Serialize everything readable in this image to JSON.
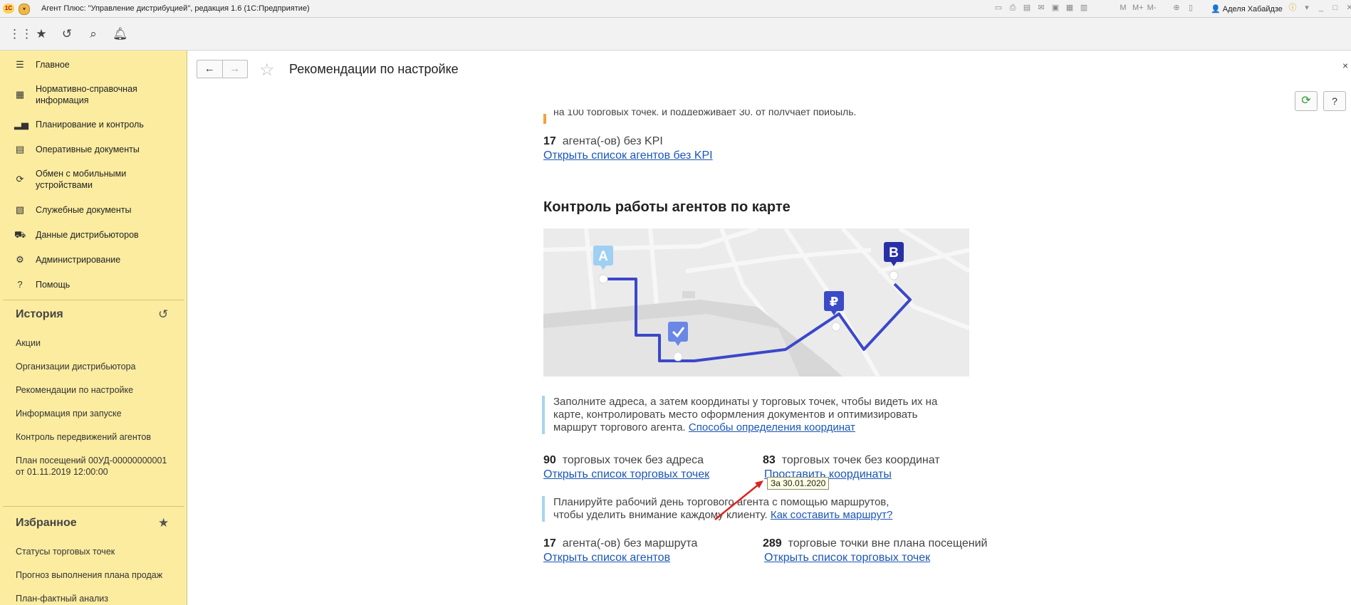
{
  "window": {
    "logo": "1С",
    "title": "Агент Плюс: \"Управление дистрибуцией\", редакция 1.6  (1С:Предприятие)",
    "user": "Аделя Хабайдзе",
    "memory_labels": [
      "M",
      "M+",
      "M-"
    ]
  },
  "sidebar": {
    "items": [
      {
        "label": "Главное",
        "icon": "menu-icon"
      },
      {
        "label": "Нормативно-справочная информация",
        "icon": "grid-icon"
      },
      {
        "label": "Планирование и контроль",
        "icon": "chart-icon"
      },
      {
        "label": "Оперативные документы",
        "icon": "docs-icon"
      },
      {
        "label": "Обмен с мобильными устройствами",
        "icon": "sync-icon"
      },
      {
        "label": "Служебные документы",
        "icon": "service-docs-icon"
      },
      {
        "label": "Данные дистрибьюторов",
        "icon": "distributor-icon"
      },
      {
        "label": "Администрирование",
        "icon": "gear-icon"
      },
      {
        "label": "Помощь",
        "icon": "question-icon"
      }
    ],
    "history_title": "История",
    "history_items": [
      "Акции",
      "Организации дистрибьютора",
      "Рекомендации по настройке",
      "Информация при запуске",
      "Контроль передвижений агентов",
      "План посещений 00УД-00000000001 от 01.11.2019 12:00:00"
    ],
    "favorites_title": "Избранное",
    "favorites_items": [
      "Статусы торговых точек",
      "Прогноз выполнения плана продаж",
      "План-фактный анализ"
    ]
  },
  "page": {
    "title": "Рекомендации по настройке",
    "top_cut_text": "на 100 торговых точек, и поддерживает 30, от получает прибыль.",
    "agents_no_kpi": {
      "count": "17",
      "text": "агента(-ов) без KPI",
      "link": "Открыть список агентов без KPI"
    },
    "map_section_title": "Контроль работы агентов по карте",
    "map_markers": {
      "a": "A",
      "b": "B",
      "ruble": "₽"
    },
    "note1": {
      "text": "Заполните адреса, а затем координаты у торговых точек, чтобы видеть их на карте, контролировать место оформления документов и оптимизировать маршрут торгового агента.",
      "link": "Способы определения координат"
    },
    "points_no_address": {
      "count": "90",
      "text": "торговых точек без адреса",
      "link": "Открыть список торговых точек"
    },
    "points_no_coords": {
      "count": "83",
      "text": "торговых точек без координат",
      "link": "Проставить координаты"
    },
    "tooltip": "За 30.01.2020",
    "note2": {
      "text": "Планируйте рабочий день торгового агента с помощью маршрутов, чтобы уделить внимание каждому клиенту.",
      "link": "Как составить маршрут?"
    },
    "agents_no_route": {
      "count": "17",
      "text": "агента(-ов) без маршрута",
      "link": "Открыть список агентов"
    },
    "points_out_of_plan": {
      "count": "289",
      "text": "торговые точки вне плана посещений",
      "link": "Открыть список торговых точек"
    }
  },
  "colors": {
    "sidebar_bg": "#fbeca0",
    "link": "#1a56b8",
    "route": "#3b47c9",
    "note_bar": "#a6d4ef"
  }
}
